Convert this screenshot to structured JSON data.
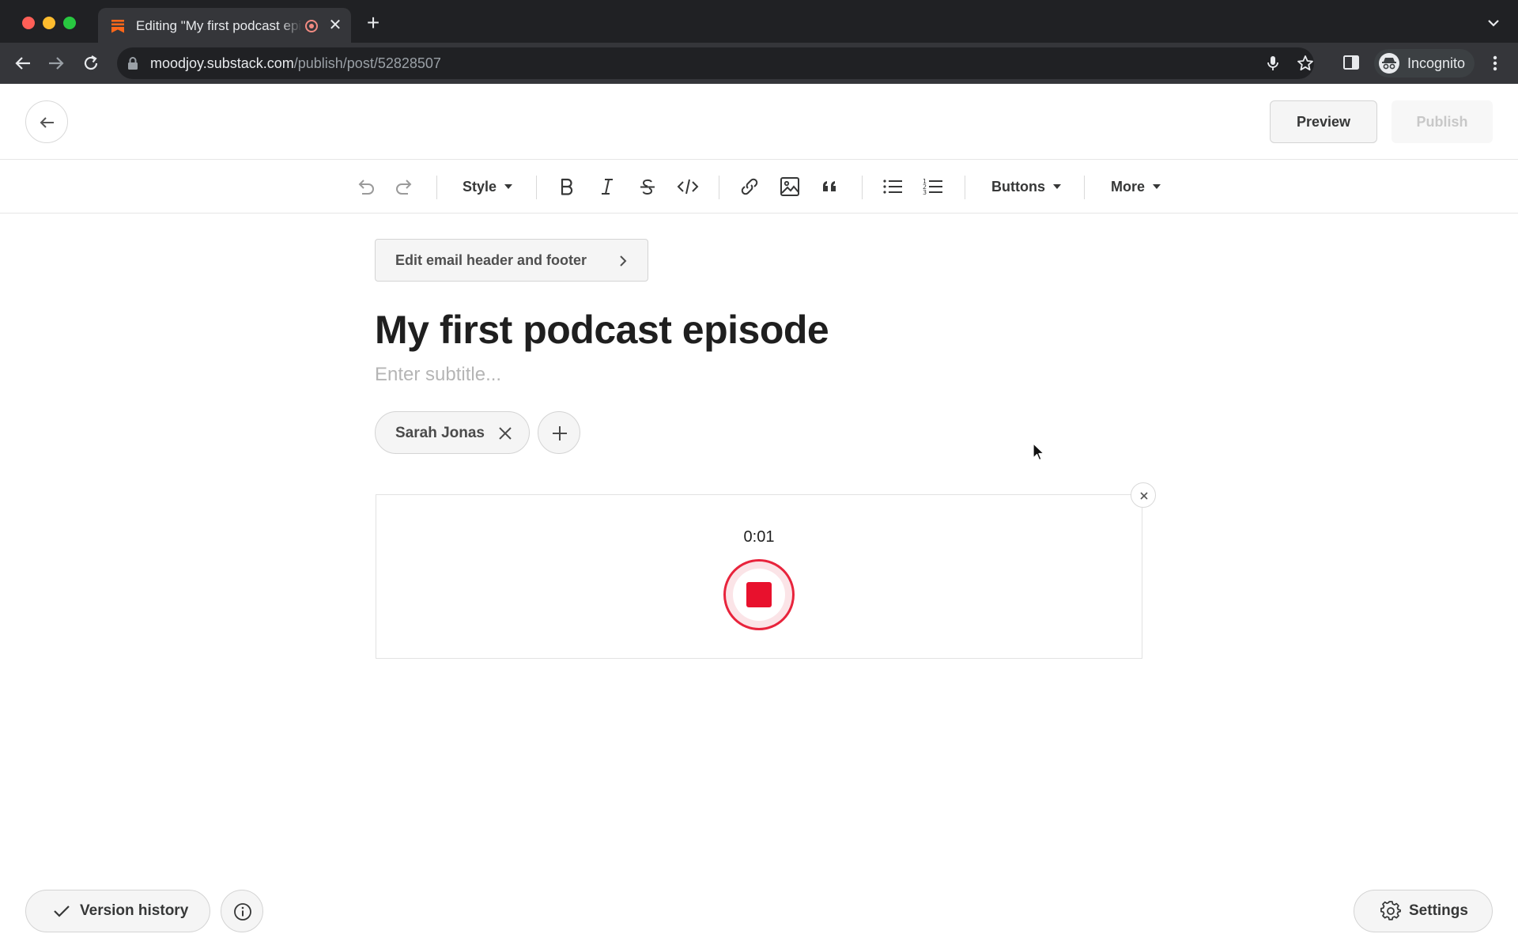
{
  "browser": {
    "tab_title": "Editing \"My first podcast episode\"",
    "url_domain": "moodjoy.substack.com",
    "url_path": "/publish/post/52828507",
    "profile_label": "Incognito",
    "newtab_symbol": "+",
    "tab_close_symbol": "✕"
  },
  "header": {
    "preview_label": "Preview",
    "publish_label": "Publish"
  },
  "toolbar": {
    "style_label": "Style",
    "buttons_label": "Buttons",
    "more_label": "More"
  },
  "editor": {
    "edit_email_label": "Edit email header and footer",
    "title": "My first podcast episode",
    "subtitle_placeholder": "Enter subtitle...",
    "author_name": "Sarah Jonas"
  },
  "recorder": {
    "elapsed_time": "0:01"
  },
  "footer": {
    "version_history_label": "Version history",
    "settings_label": "Settings"
  },
  "colors": {
    "accent_red": "#e8112d",
    "brand_orange": "#ff6719"
  }
}
